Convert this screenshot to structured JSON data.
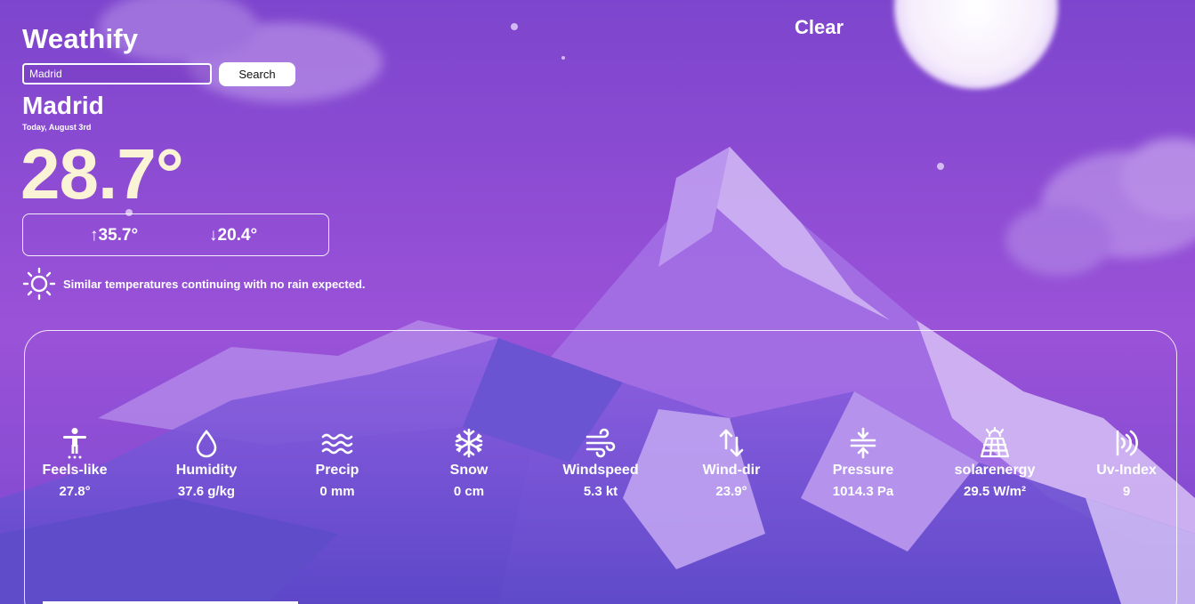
{
  "app": {
    "title": "Weathify"
  },
  "search": {
    "value": "Madrid",
    "button_label": "Search"
  },
  "current": {
    "condition": "Clear",
    "city": "Madrid",
    "date": "Today, August 3rd",
    "temperature": "28.7°",
    "max_temp": "↑35.7°",
    "min_temp": "↓20.4°",
    "icon": "sun-icon",
    "description": "Similar temperatures continuing with no rain expected."
  },
  "stats": [
    {
      "label": "Feels-like",
      "value": "27.8°",
      "icon": "person-icon"
    },
    {
      "label": "Humidity",
      "value": "37.6 g/kg",
      "icon": "water-drop-icon"
    },
    {
      "label": "Precip",
      "value": "0 mm",
      "icon": "waves-icon"
    },
    {
      "label": "Snow",
      "value": "0 cm",
      "icon": "snowflake-icon"
    },
    {
      "label": "Windspeed",
      "value": "5.3 kt",
      "icon": "wind-icon"
    },
    {
      "label": "Wind-dir",
      "value": "23.9°",
      "icon": "arrows-updown-icon"
    },
    {
      "label": "Pressure",
      "value": "1014.3 Pa",
      "icon": "compress-icon"
    },
    {
      "label": "solarenergy",
      "value": "29.5 W/m²",
      "icon": "solar-panel-icon"
    },
    {
      "label": "Uv-Index",
      "value": "9",
      "icon": "uv-signal-icon"
    }
  ],
  "colors": {
    "background": "#8a4fd0",
    "temperature": "#fbf3d5",
    "text": "#ffffff"
  }
}
